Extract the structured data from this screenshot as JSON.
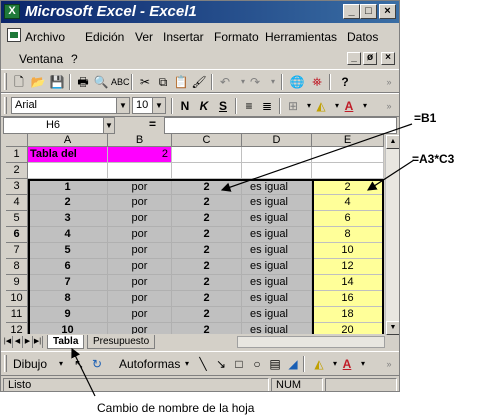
{
  "window": {
    "app_title": "Microsoft Excel - Excel1"
  },
  "title_buttons": {
    "minimize": "_",
    "maximize": "□",
    "close": "×"
  },
  "menu": {
    "items": [
      "Archivo",
      "Edición",
      "Ver",
      "Insertar",
      "Formato",
      "Herramientas",
      "Datos"
    ],
    "items_row2": [
      "Ventana",
      "?"
    ]
  },
  "doc_buttons": {
    "minimize": "_",
    "restore": "ø",
    "close": "×"
  },
  "formatting": {
    "font_name": "Arial",
    "font_size": "10",
    "bold": "N",
    "italic": "K",
    "underline": "S"
  },
  "formula_bar": {
    "cell_ref": "H6",
    "equals": "=",
    "formula": ""
  },
  "sheet": {
    "columns": [
      "A",
      "B",
      "C",
      "D",
      "E"
    ],
    "rows": [
      "1",
      "2",
      "3",
      "4",
      "5",
      "6",
      "7",
      "8",
      "9",
      "10",
      "11",
      "12"
    ],
    "header_cell": {
      "label": "Tabla del",
      "value": "2"
    },
    "table_rows": [
      {
        "a": "1",
        "b": "por",
        "c": "2",
        "d": "es igual",
        "e": "2"
      },
      {
        "a": "2",
        "b": "por",
        "c": "2",
        "d": "es igual",
        "e": "4"
      },
      {
        "a": "3",
        "b": "por",
        "c": "2",
        "d": "es igual",
        "e": "6"
      },
      {
        "a": "4",
        "b": "por",
        "c": "2",
        "d": "es igual",
        "e": "8"
      },
      {
        "a": "5",
        "b": "por",
        "c": "2",
        "d": "es igual",
        "e": "10"
      },
      {
        "a": "6",
        "b": "por",
        "c": "2",
        "d": "es igual",
        "e": "12"
      },
      {
        "a": "7",
        "b": "por",
        "c": "2",
        "d": "es igual",
        "e": "14"
      },
      {
        "a": "8",
        "b": "por",
        "c": "2",
        "d": "es igual",
        "e": "16"
      },
      {
        "a": "9",
        "b": "por",
        "c": "2",
        "d": "es igual",
        "e": "18"
      },
      {
        "a": "10",
        "b": "por",
        "c": "2",
        "d": "es igual",
        "e": "20"
      }
    ]
  },
  "tabs": [
    "Tabla",
    "Presupuesto"
  ],
  "drawing": {
    "draw_label": "Dibujo",
    "autoshapes_label": "Autoformas"
  },
  "status": {
    "ready": "Listo",
    "num": "NUM"
  },
  "annotations": {
    "b1": "=B1",
    "a3c3": "=A3*C3",
    "caption": "Cambio de nombre de la hoja"
  },
  "colors": {
    "title_bar": "#0a246a",
    "chrome": "#d4d0c8",
    "header_cell": "#ff00ff",
    "table_fill": "#c0c0c0",
    "result_fill": "#ffff99"
  }
}
